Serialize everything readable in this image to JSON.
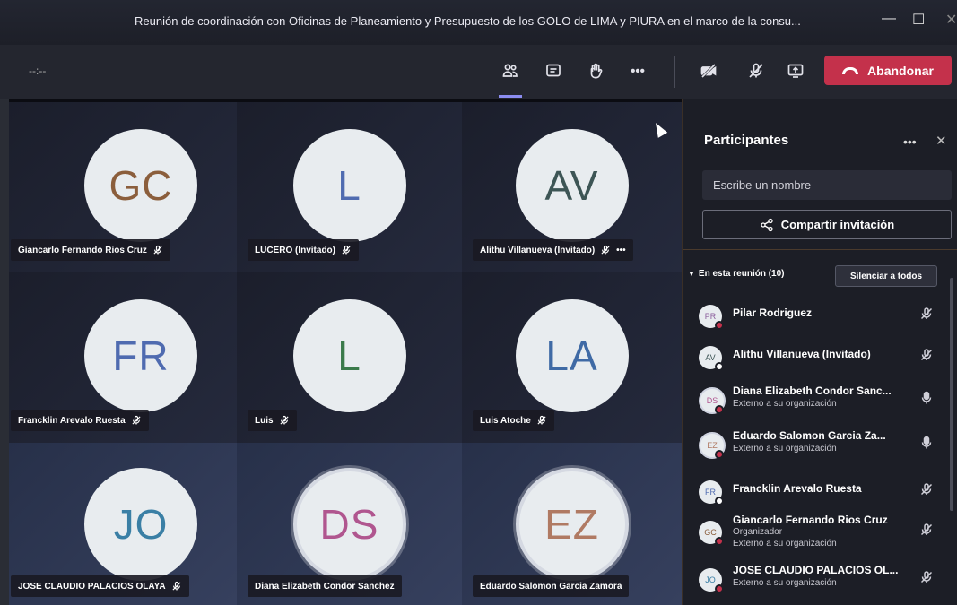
{
  "window": {
    "title": "Reunión de coordinación con Oficinas de Planeamiento y Presupuesto de los GOLO de LIMA y PIURA en el marco de la consu...",
    "timer": "--:--"
  },
  "toolbar": {
    "leave_label": "Abandonar",
    "icons": [
      "participants-icon",
      "chat-icon",
      "raise-hand-icon",
      "more-icon",
      "camera-off-icon",
      "mic-off-icon",
      "share-screen-icon"
    ]
  },
  "grid": {
    "tiles": [
      {
        "initials": "GC",
        "name": "Giancarlo Fernando Rios Cruz",
        "color": "#8b5e3c",
        "muted": true
      },
      {
        "initials": "L",
        "name": "LUCERO (Invitado)",
        "color": "#4f6bb0",
        "muted": true
      },
      {
        "initials": "AV",
        "name": "Alithu Villanueva (Invitado)",
        "color": "#3d5555",
        "muted": true,
        "more": "•••"
      },
      {
        "initials": "FR",
        "name": "Francklin Arevalo Ruesta",
        "color": "#4f6bb0",
        "muted": true
      },
      {
        "initials": "L",
        "name": "Luis",
        "color": "#3a7a4a",
        "muted": true
      },
      {
        "initials": "LA",
        "name": "Luis Atoche",
        "color": "#3f6aa5",
        "muted": true
      },
      {
        "initials": "JO",
        "name": "JOSE CLAUDIO PALACIOS OLAYA",
        "color": "#3a7fa5",
        "muted": true
      },
      {
        "initials": "DS",
        "name": "Diana Elizabeth Condor Sanchez",
        "color": "#b0568f",
        "muted": false
      },
      {
        "initials": "EZ",
        "name": "Eduardo Salomon Garcia Zamora",
        "color": "#b07a63",
        "muted": false
      }
    ]
  },
  "panel": {
    "title": "Participantes",
    "more": "•••",
    "close": "✕",
    "search_placeholder": "Escribe un nombre",
    "share_label": "Compartir invitación",
    "section_label": "En esta reunión (10)",
    "mute_all_label": "Silenciar a todos",
    "participants": [
      {
        "initials": "PR",
        "name": "Pilar Rodriguez",
        "sub1": "",
        "sub2": "",
        "mic": "off",
        "dot": "#c4314b",
        "ring": false,
        "avcolor": "#8b5e9c"
      },
      {
        "initials": "AV",
        "name": "Alithu Villanueva (Invitado)",
        "sub1": "",
        "sub2": "",
        "mic": "off",
        "dot": "#ffffff",
        "ring": false,
        "avcolor": "#3d5555"
      },
      {
        "initials": "DS",
        "name": "Diana Elizabeth Condor Sanc...",
        "sub1": "Externo a su organización",
        "sub2": "",
        "mic": "on",
        "dot": "#c4314b",
        "ring": true,
        "avcolor": "#b0568f"
      },
      {
        "initials": "EZ",
        "name": "Eduardo Salomon Garcia Za...",
        "sub1": "Externo a su organización",
        "sub2": "",
        "mic": "on",
        "dot": "#c4314b",
        "ring": true,
        "avcolor": "#b07a63"
      },
      {
        "initials": "FR",
        "name": "Francklin Arevalo Ruesta",
        "sub1": "",
        "sub2": "",
        "mic": "off",
        "dot": "#ffffff",
        "ring": false,
        "avcolor": "#4f6bb0"
      },
      {
        "initials": "GC",
        "name": "Giancarlo Fernando Rios Cruz",
        "sub1": "Organizador",
        "sub2": "Externo a su organización",
        "mic": "off",
        "dot": "#c4314b",
        "ring": false,
        "avcolor": "#8b5e3c"
      },
      {
        "initials": "JO",
        "name": "JOSE CLAUDIO PALACIOS OL...",
        "sub1": "Externo a su organización",
        "sub2": "",
        "mic": "off",
        "dot": "#c4314b",
        "ring": false,
        "avcolor": "#3a7fa5"
      }
    ]
  }
}
